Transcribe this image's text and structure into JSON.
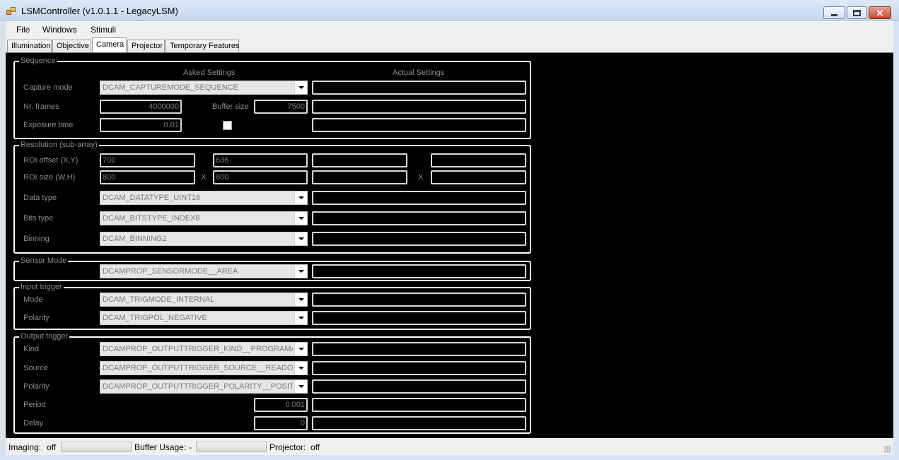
{
  "window": {
    "title": "LSMController (v1.0.1.1 - LegacyLSM)",
    "close_glyph": "✕"
  },
  "menu": [
    "File",
    "Windows",
    "Stimuli"
  ],
  "tabs": [
    {
      "label": "Illumination",
      "active": false
    },
    {
      "label": "Objective",
      "active": false
    },
    {
      "label": "Camera",
      "active": true
    },
    {
      "label": "Projector",
      "active": false
    },
    {
      "label": "Temporary Features",
      "active": false
    }
  ],
  "sequence": {
    "legend": "Sequence",
    "asked_header": "Asked Settings",
    "actual_header": "Actual Settings",
    "capture_mode_label": "Capture mode",
    "capture_mode_value": "DCAM_CAPTUREMODE_SEQUENCE",
    "nr_frames_label": "Nr. frames",
    "nr_frames_value": "4000000",
    "buffer_size_label": "Buffer size",
    "buffer_size_value": "7500",
    "exposure_label": "Exposure time",
    "exposure_value": "0.01"
  },
  "resolution": {
    "legend": "Resolution (sub-array)",
    "roi_offset_label": "ROI offset (X,Y)",
    "roi_offset_x": "700",
    "roi_offset_y": "636",
    "roi_size_label": "ROI size (W,H)",
    "roi_size_w": "800",
    "roi_size_h": "800",
    "x_separator": "X",
    "data_type_label": "Data type",
    "data_type_value": "DCAM_DATATYPE_UINT16",
    "bits_type_label": "Bits type",
    "bits_type_value": "DCAM_BITSTYPE_INDEX8",
    "binning_label": "Binning",
    "binning_value": "DCAM_BINNING2"
  },
  "sensor": {
    "legend": "Sensor Mode",
    "value": "DCAMPROP_SENSORMODE__AREA"
  },
  "input_trigger": {
    "legend": "Input trigger",
    "mode_label": "Mode",
    "mode_value": "DCAM_TRIGMODE_INTERNAL",
    "polarity_label": "Polarity",
    "polarity_value": "DCAM_TRIGPOL_NEGATIVE"
  },
  "output_trigger": {
    "legend": "Output trigger",
    "kind_label": "Kind",
    "kind_value": "DCAMPROP_OUTPUTTRIGGER_KIND__PROGRAMABLE",
    "source_label": "Source",
    "source_value": "DCAMPROP_OUTPUTTRIGGER_SOURCE__READOUTEND",
    "polarity_label": "Polarity",
    "polarity_value": "DCAMPROP_OUTPUTTRIGGER_POLARITY__POSITIVE",
    "period_label": "Period",
    "period_value": "0.001",
    "delay_label": "Delay",
    "delay_value": "0"
  },
  "status": {
    "imaging_label": "Imaging:",
    "imaging_value": "off",
    "buffer_label": "Buffer Usage:",
    "buffer_value": "-",
    "projector_label": "Projector:",
    "projector_value": "off"
  }
}
